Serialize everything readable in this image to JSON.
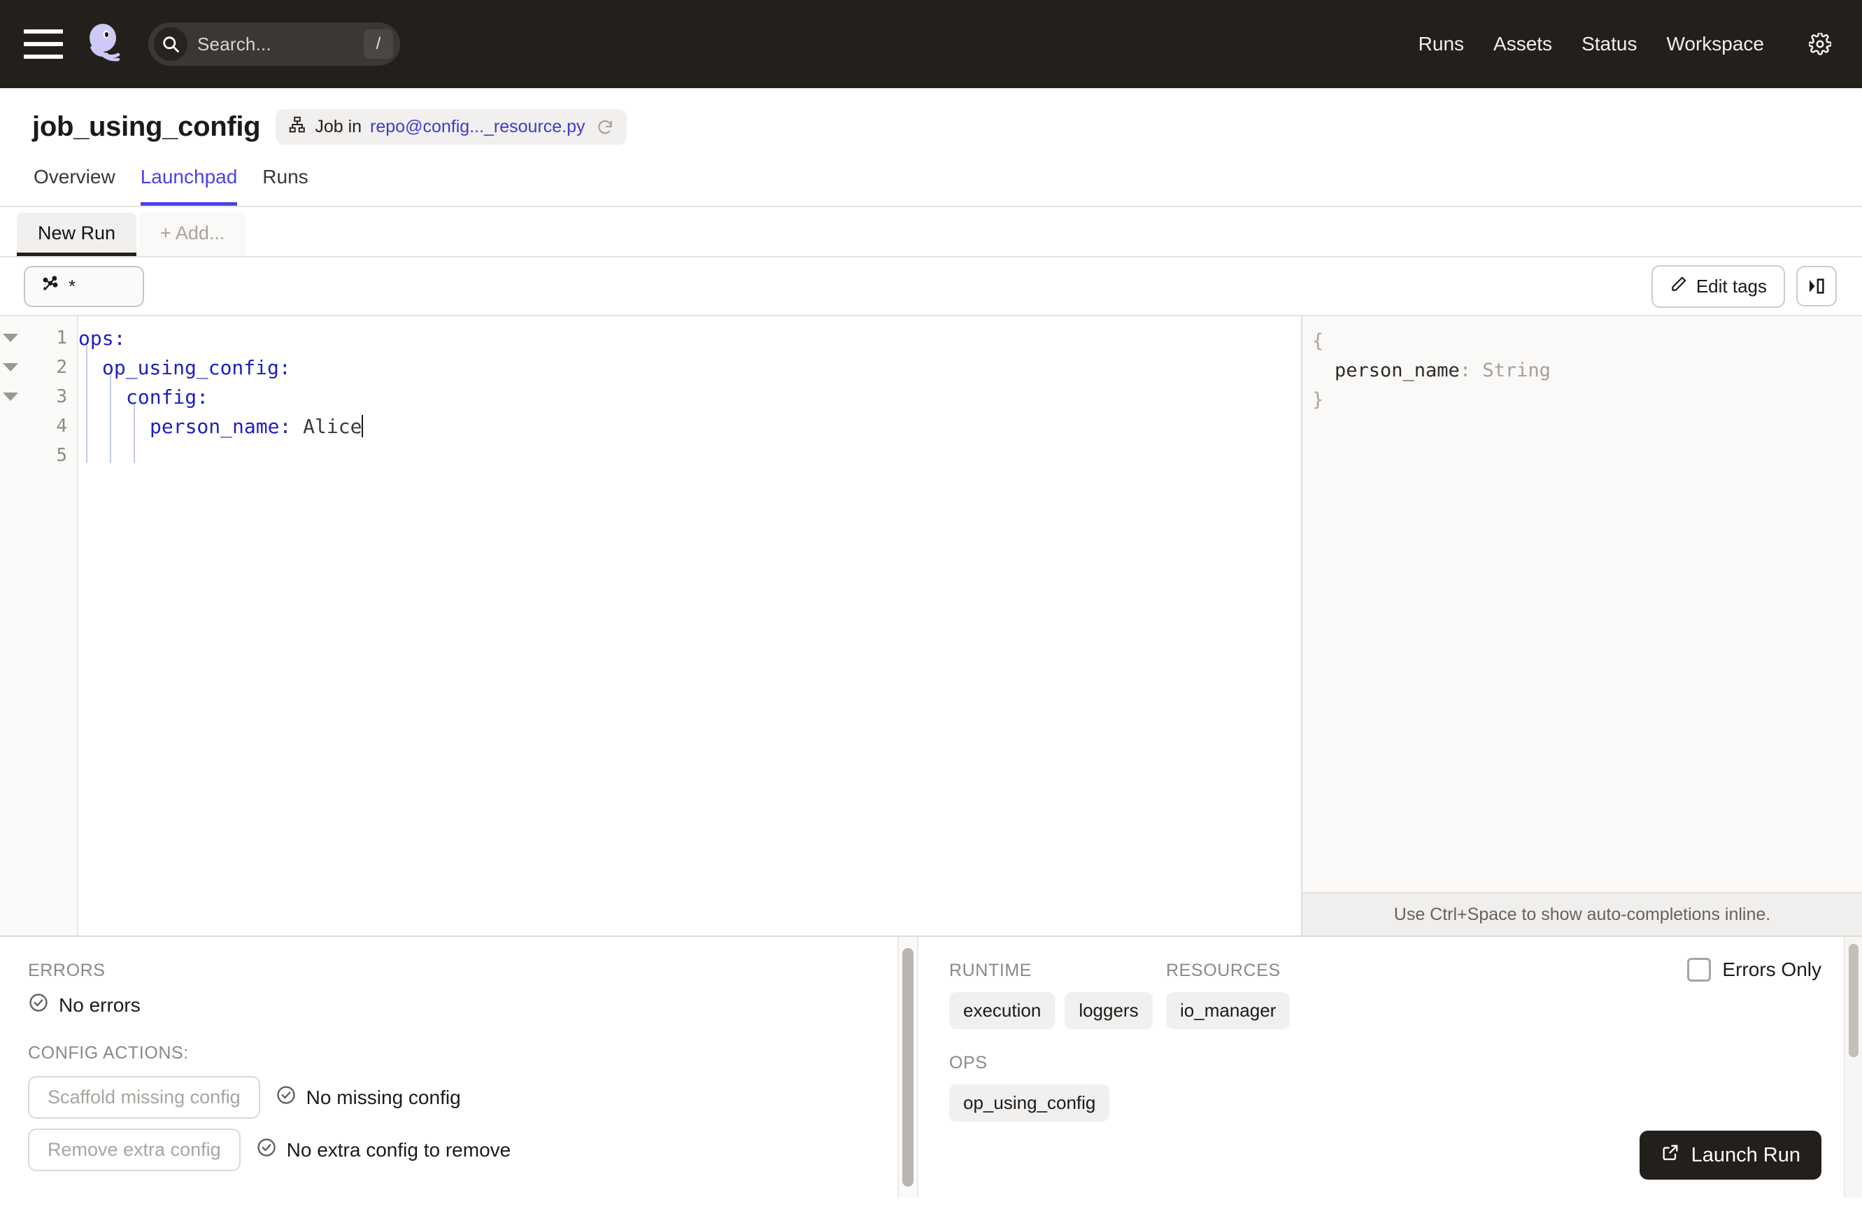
{
  "topnav": {
    "menu_icon": "hamburger-icon",
    "logo_icon": "dagster-logo",
    "search_placeholder": "Search...",
    "search_shortcut": "/",
    "search_icon": "search-icon",
    "links": [
      "Runs",
      "Assets",
      "Status",
      "Workspace"
    ],
    "settings_icon": "gear-icon",
    "background": "#231F1B"
  },
  "header": {
    "title": "job_using_config",
    "badge_prefix": "Job in",
    "badge_link": "repo@config..._resource.py",
    "badge_icon": "job-graph-icon",
    "refresh_icon": "refresh-icon",
    "tabs": [
      {
        "label": "Overview",
        "active": false
      },
      {
        "label": "Launchpad",
        "active": true
      },
      {
        "label": "Runs",
        "active": false
      }
    ],
    "accent": "#4b41e8"
  },
  "session_tabs": [
    {
      "label": "New Run",
      "active": true
    },
    {
      "label": "+ Add...",
      "active": false
    }
  ],
  "selector_row": {
    "op_selector_icon": "op-selection-icon",
    "op_selector_value": "*",
    "edit_tags_label": "Edit tags",
    "edit_tags_icon": "pencil-icon",
    "panel_toggle_icon": "toggle-right-panel-icon"
  },
  "editor": {
    "lines": [
      {
        "no": "1",
        "fold": true,
        "indent": 0,
        "key": "ops",
        "colon": ":",
        "value": ""
      },
      {
        "no": "2",
        "fold": true,
        "indent": 1,
        "key": "op_using_config",
        "colon": ":",
        "value": ""
      },
      {
        "no": "3",
        "fold": true,
        "indent": 2,
        "key": "config",
        "colon": ":",
        "value": ""
      },
      {
        "no": "4",
        "fold": false,
        "indent": 3,
        "key": "person_name",
        "colon": ":",
        "value": "Alice"
      },
      {
        "no": "5",
        "fold": false,
        "indent": 0,
        "key": "",
        "colon": "",
        "value": ""
      }
    ]
  },
  "schema_panel": {
    "open_brace": "{",
    "field_key": "person_name",
    "field_colon": ":",
    "field_type": "String",
    "close_brace": "}",
    "hint": "Use Ctrl+Space to show auto-completions inline."
  },
  "errors_panel": {
    "errors_label": "ERRORS",
    "errors_status": "No errors",
    "errors_status_icon": "check-circle-icon",
    "config_actions_label": "CONFIG ACTIONS:",
    "actions": [
      {
        "button": "Scaffold missing config",
        "status": "No missing config",
        "icon": "check-circle-icon"
      },
      {
        "button": "Remove extra config",
        "status": "No extra config to remove",
        "icon": "check-circle-icon"
      }
    ]
  },
  "runtime_panel": {
    "runtime_label": "RUNTIME",
    "runtime_chips": [
      "execution",
      "loggers"
    ],
    "resources_label": "RESOURCES",
    "resources_chips": [
      "io_manager"
    ],
    "ops_label": "OPS",
    "ops_chips": [
      "op_using_config"
    ],
    "errors_only_label": "Errors Only",
    "errors_only_checked": false,
    "launch_label": "Launch Run",
    "launch_icon": "external-link-icon"
  }
}
